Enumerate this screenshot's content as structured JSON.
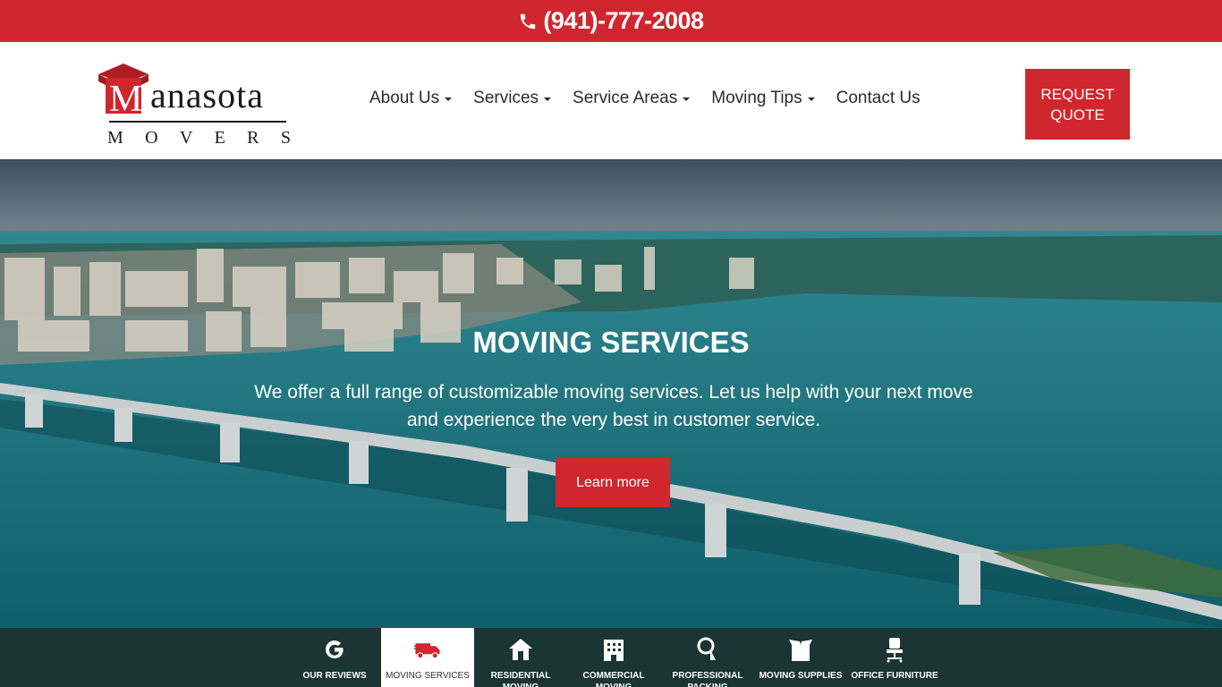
{
  "topbar": {
    "phone": "(941)-777-2008",
    "phone_icon": "phone-icon"
  },
  "brand": {
    "name_initial": "M",
    "name_rest": "anasota",
    "sub_letters": [
      "M",
      "O",
      "V",
      "E",
      "R",
      "S"
    ],
    "color": "#d0262d"
  },
  "nav": {
    "items": [
      {
        "label": "About Us",
        "dropdown": true
      },
      {
        "label": "Services",
        "dropdown": true
      },
      {
        "label": "Service Areas",
        "dropdown": true
      },
      {
        "label": "Moving Tips",
        "dropdown": true
      },
      {
        "label": "Contact Us",
        "dropdown": false
      }
    ]
  },
  "quote_button": {
    "line1": "REQUEST",
    "line2": "QUOTE"
  },
  "hero": {
    "title": "MOVING SERVICES",
    "text": "We offer a full range of customizable moving services. Let us help with your next move and experience the very best in customer service.",
    "button": "Learn more"
  },
  "services": [
    {
      "label": "OUR REVIEWS",
      "icon": "google-icon",
      "active": false
    },
    {
      "label": "MOVING SERVICES",
      "icon": "truck-icon",
      "active": true
    },
    {
      "label": "RESIDENTIAL MOVING",
      "icon": "house-icon",
      "active": false
    },
    {
      "label": "COMMERCIAL MOVING",
      "icon": "building-icon",
      "active": false
    },
    {
      "label": "PROFESSIONAL PACKING",
      "icon": "tape-icon",
      "active": false
    },
    {
      "label": "MOVING SUPPLIES",
      "icon": "box-icon",
      "active": false
    },
    {
      "label": "OFFICE FURNITURE",
      "icon": "office-chair-icon",
      "active": false
    }
  ],
  "colors": {
    "accent": "#d0262d",
    "service_bar": "#1b3434",
    "water": "#2b7c86"
  }
}
